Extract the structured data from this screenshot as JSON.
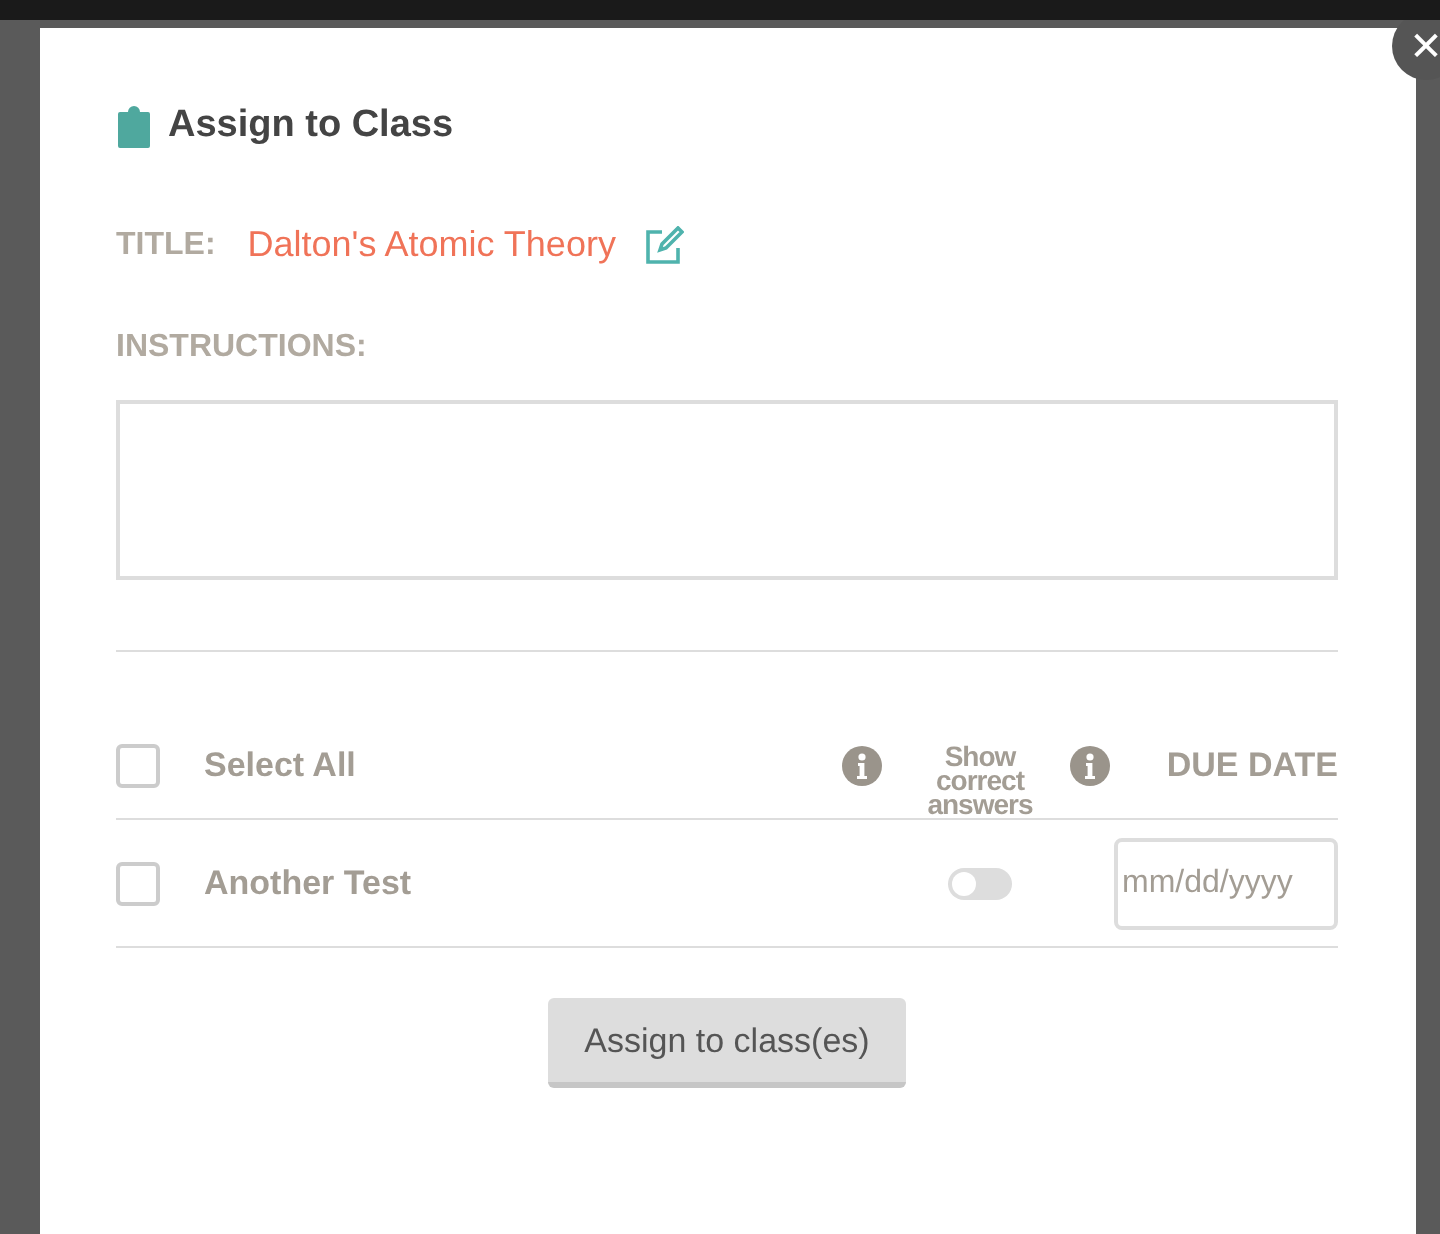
{
  "dialog": {
    "title": "Assign to Class",
    "close": "✕"
  },
  "title_field": {
    "label": "TITLE:",
    "value": "Dalton's Atomic Theory"
  },
  "instructions": {
    "label": "INSTRUCTIONS:"
  },
  "header": {
    "select_all": {
      "label": "Select All",
      "checked": false
    },
    "show_answers": "Show correct answers",
    "due_date": "DUE DATE"
  },
  "classes": [
    {
      "name": "Another Test",
      "checked": false,
      "show_answers": false,
      "date_placeholder": "mm/dd/yyyy"
    }
  ],
  "button": "Assign to class(es)"
}
